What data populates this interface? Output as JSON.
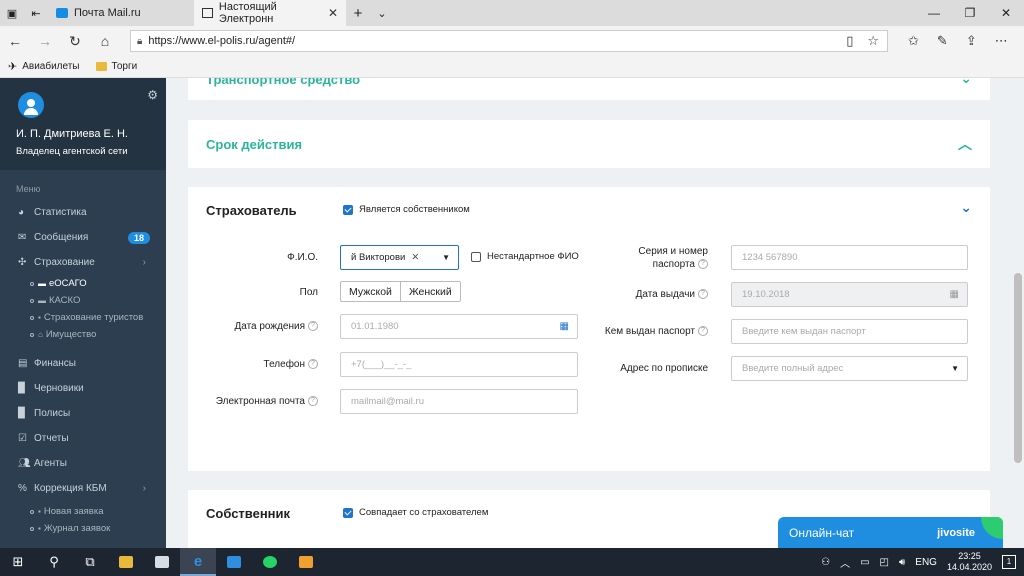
{
  "browser": {
    "tabs": [
      {
        "label": "Почта Mail.ru"
      },
      {
        "label": "Настоящий Электронн"
      }
    ],
    "url": "https://www.el-polis.ru/agent#/",
    "favorites": [
      {
        "label": "Авиабилеты"
      },
      {
        "label": "Торги"
      }
    ]
  },
  "sidebar": {
    "user_name": "И. П. Дмитриева Е. Н.",
    "user_role": "Владелец агентской сети",
    "menu_heading": "Меню",
    "items": [
      {
        "label": "Статистика"
      },
      {
        "label": "Сообщения",
        "badge": "18"
      },
      {
        "label": "Страхование"
      },
      {
        "label": "Финансы"
      },
      {
        "label": "Черновики"
      },
      {
        "label": "Полисы"
      },
      {
        "label": "Отчеты"
      },
      {
        "label": "Агенты"
      },
      {
        "label": "Коррекция КБМ"
      }
    ],
    "insurance_sub": [
      {
        "label": "еОСАГО"
      },
      {
        "label": "КАСКО"
      },
      {
        "label": "Страхование туристов"
      },
      {
        "label": "Имущество"
      }
    ],
    "kbm_sub": [
      {
        "label": "Новая заявка"
      },
      {
        "label": "Журнал заявок"
      }
    ]
  },
  "main": {
    "vehicle_title": "Транспортное средство",
    "validity_title": "Срок действия",
    "policyholder": {
      "title": "Страхователь",
      "is_owner_label": "Является собственником",
      "fio_label": "Ф.И.О.",
      "fio_value": "й Викторови",
      "nonstandard_label": "Нестандартное ФИО",
      "gender_label": "Пол",
      "gender_male": "Мужской",
      "gender_female": "Женский",
      "birth_label": "Дата рождения",
      "birth_placeholder": "01.01.1980",
      "phone_label": "Телефон",
      "phone_placeholder": "+7(___)__-_-_",
      "email_label": "Электронная почта",
      "email_placeholder": "mailmail@mail.ru",
      "passport_label_1": "Серия и номер",
      "passport_label_2": "паспорта",
      "passport_placeholder": "1234 567890",
      "issue_date_label": "Дата выдачи",
      "issue_date_placeholder": "19.10.2018",
      "issued_by_label": "Кем выдан паспорт",
      "issued_by_placeholder": "Введите кем выдан паспорт",
      "address_label": "Адрес по прописке",
      "address_placeholder": "Введите полный адрес"
    },
    "owner": {
      "title": "Собственник",
      "same_label": "Совпадает со страхователем"
    }
  },
  "chat": {
    "label": "Онлайн-чат",
    "brand": "jivosite"
  },
  "taskbar": {
    "lang": "ENG",
    "time": "23:25",
    "date": "14.04.2020",
    "notifications": "1"
  }
}
